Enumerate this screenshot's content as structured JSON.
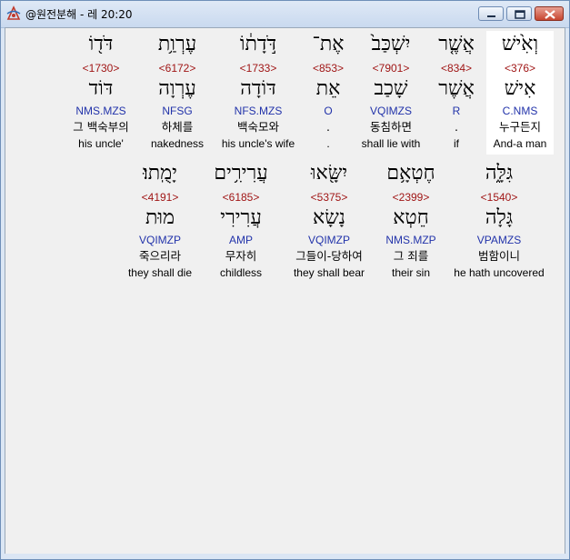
{
  "window": {
    "title": "@원전분해 - 레 20:20"
  },
  "words": [
    {
      "heb": "וְאִ֙ישׁ",
      "strong": "<376>",
      "lemma": "אִישׁ",
      "parse": "C.NMS",
      "korean": "누구든지",
      "english": "And-a man",
      "highlight": true
    },
    {
      "heb": "אֲשֶׁ֤ר",
      "strong": "<834>",
      "lemma": "אֲשֶׁר",
      "parse": "R",
      "korean": ".",
      "english": "if",
      "highlight": false
    },
    {
      "heb": "יִשְׁכַּב֙",
      "strong": "<7901>",
      "lemma": "שָׁכַב",
      "parse": "VQIMZS",
      "korean": "동침하면",
      "english": "shall lie with",
      "highlight": false
    },
    {
      "heb": "אֶת־",
      "strong": "<853>",
      "lemma": "אֵת",
      "parse": "O",
      "korean": ".",
      "english": ".",
      "highlight": false
    },
    {
      "heb": "דֹּ֣דָת֔וֹ",
      "strong": "<1733>",
      "lemma": "דּוֹדָה",
      "parse": "NFS.MZS",
      "korean": "백숙모와",
      "english": "his uncle's wife",
      "highlight": false
    },
    {
      "heb": "עֶרְוַ֥ת",
      "strong": "<6172>",
      "lemma": "עֶרְוָה",
      "parse": "NFSG",
      "korean": "하체를",
      "english": "nakedness",
      "highlight": false
    },
    {
      "heb": "דֹּד֖וֹ",
      "strong": "<1730>",
      "lemma": "דּוֹד",
      "parse": "NMS.MZS",
      "korean": "그 백숙부의",
      "english": "his uncle'",
      "highlight": false
    },
    {
      "heb": "גִּלָּ֑ה",
      "strong": "<1540>",
      "lemma": "גָּלָה",
      "parse": "VPAMZS",
      "korean": "범함이니",
      "english": "he hath uncovered",
      "highlight": false
    },
    {
      "heb": "חֶטְאָ֥ם",
      "strong": "<2399>",
      "lemma": "חֵטְא",
      "parse": "NMS.MZP",
      "korean": "그 죄를",
      "english": "their sin",
      "highlight": false
    },
    {
      "heb": "יִשָּׂ֖אוּ",
      "strong": "<5375>",
      "lemma": "נָשָׂא",
      "parse": "VQIMZP",
      "korean": "그들이-당하여",
      "english": "they shall bear",
      "highlight": false
    },
    {
      "heb": "עֲרִירִ֥ים",
      "strong": "<6185>",
      "lemma": "עֲרִירִי",
      "parse": "AMP",
      "korean": "무자히",
      "english": "childless",
      "highlight": false
    },
    {
      "heb": "יָמֻֽתוּ׃",
      "strong": "<4191>",
      "lemma": "מוּת",
      "parse": "VQIMZP",
      "korean": "죽으리라",
      "english": "they shall die",
      "highlight": false
    }
  ],
  "colors": {
    "strong": "#a01616",
    "parse": "#2233aa",
    "highlight": "#ffffff"
  }
}
